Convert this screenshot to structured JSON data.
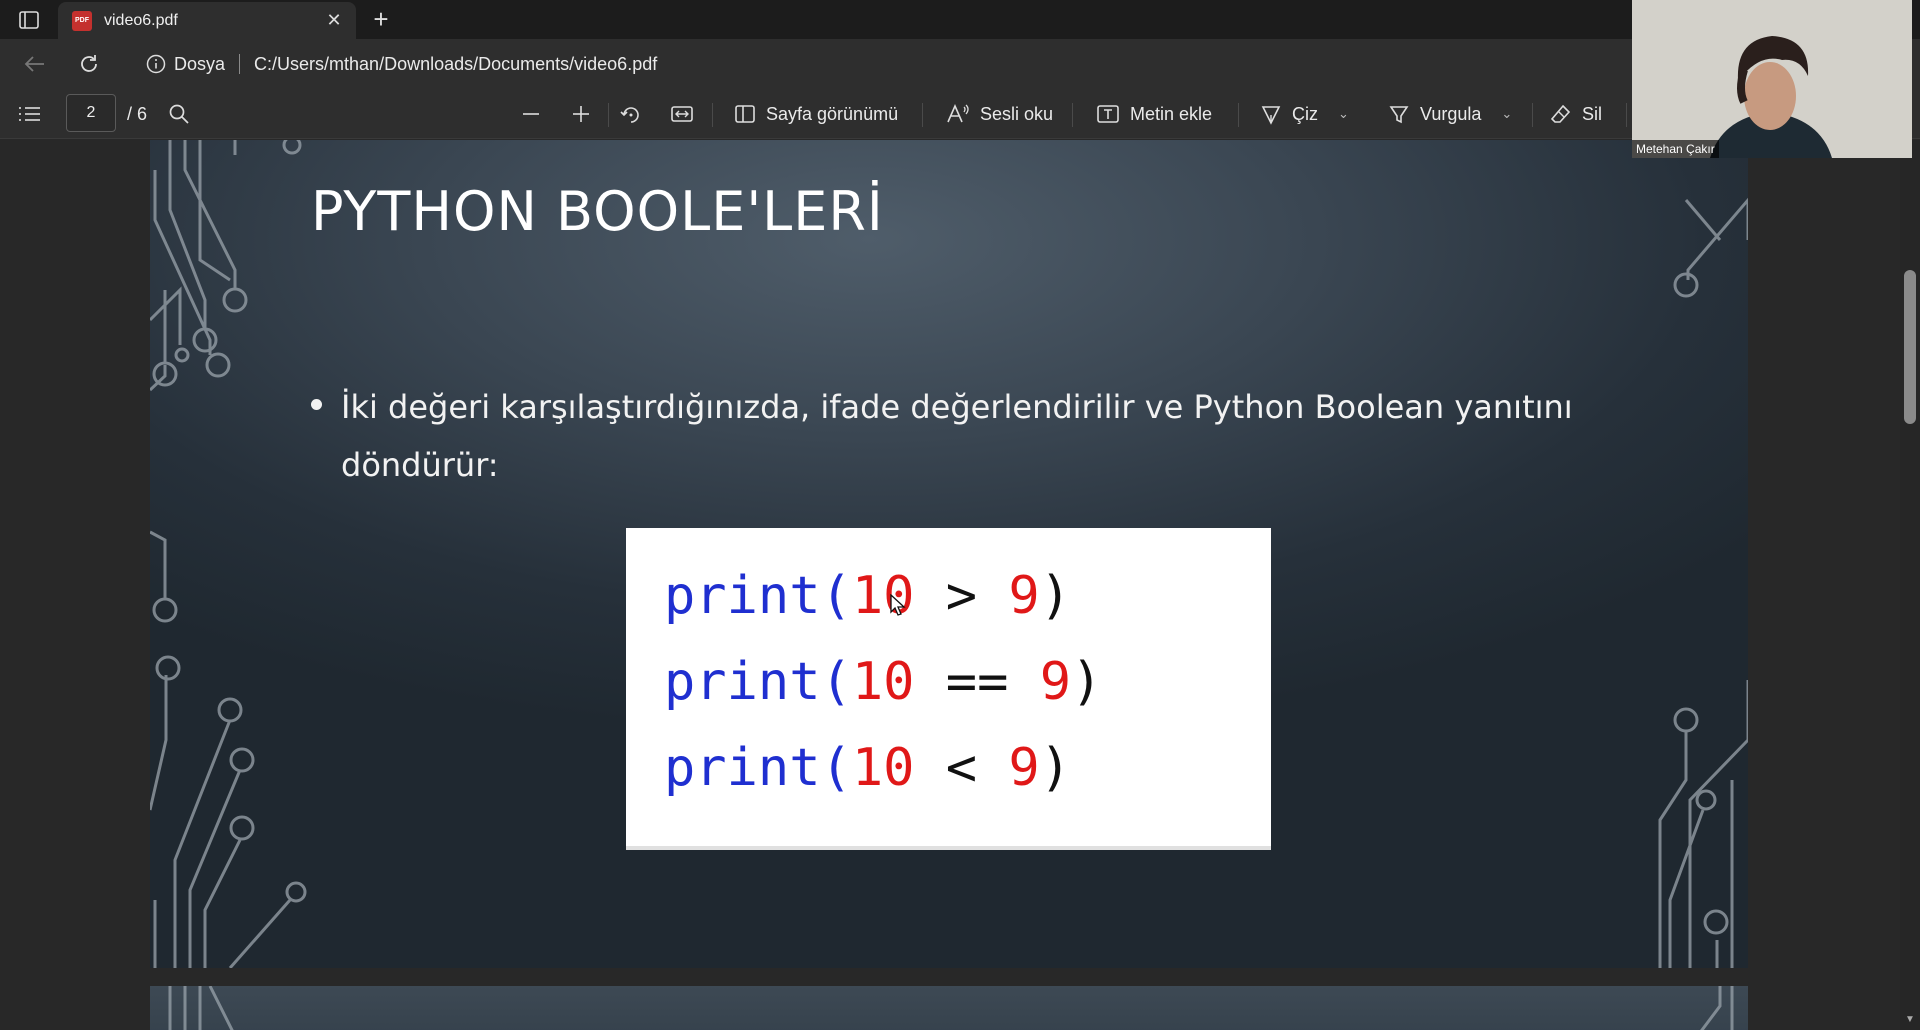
{
  "tab": {
    "title": "video6.pdf",
    "close_label": "✕",
    "new_tab_label": "+"
  },
  "address": {
    "site_label": "Dosya",
    "url": "C:/Users/mthan/Downloads/Documents/video6.pdf"
  },
  "pdf_toolbar": {
    "current_page": "2",
    "total_pages": "/ 6",
    "page_view_label": "Sayfa görünümü",
    "read_aloud_label": "Sesli oku",
    "add_text_label": "Metin ekle",
    "draw_label": "Çiz",
    "highlight_label": "Vurgula",
    "erase_label": "Sil"
  },
  "slide": {
    "title": "PYTHON BOOLE'LERİ",
    "bullet": "İki değeri karşılaştırdığınızda, ifade değerlendirilir ve Python Boolean yanıtını döndürür:",
    "code": [
      {
        "fn": "print(",
        "a": "10",
        "op": " > ",
        "b": "9",
        "close": ")"
      },
      {
        "fn": "print(",
        "a": "10",
        "op": " == ",
        "b": "9",
        "close": ")"
      },
      {
        "fn": "print(",
        "a": "10",
        "op": " < ",
        "b": "9",
        "close": ")"
      }
    ]
  },
  "webcam": {
    "participant_name": "Metehan Çakır"
  },
  "colors": {
    "code_keyword": "#1f2fd0",
    "code_number": "#e01818",
    "pdf_icon": "#c4312e"
  }
}
